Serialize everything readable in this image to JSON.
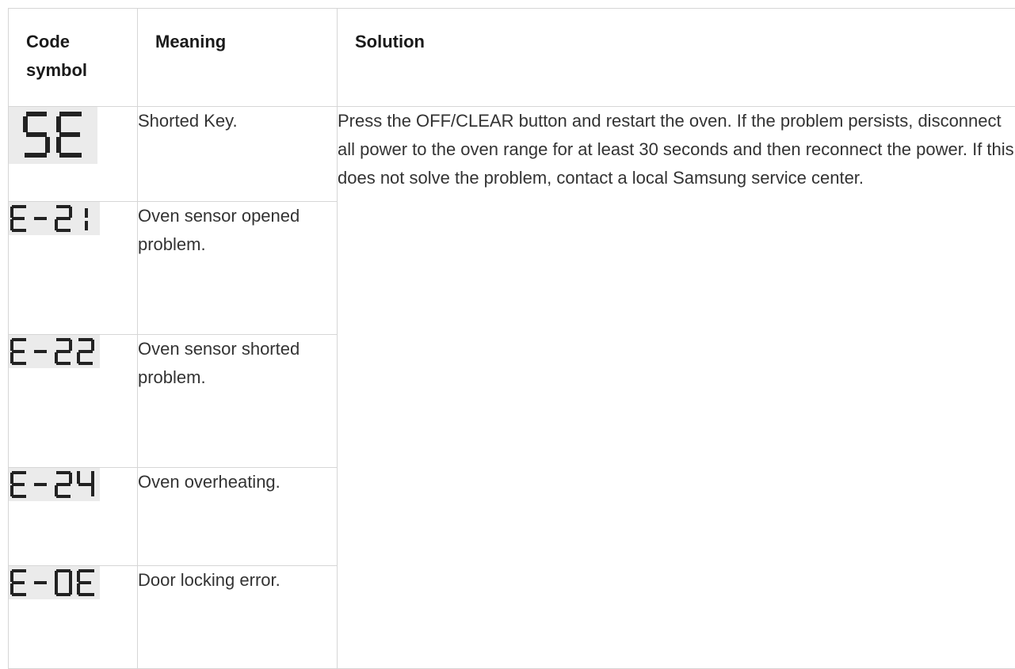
{
  "headers": {
    "code": "Code symbol",
    "meaning": "Meaning",
    "solution": "Solution"
  },
  "rows": [
    {
      "code_icon": "SE-display-icon",
      "code": "SE",
      "meaning": "Shorted Key."
    },
    {
      "code_icon": "E-21-display-icon",
      "code": "E-21",
      "meaning": "Oven sensor opened problem."
    },
    {
      "code_icon": "E-22-display-icon",
      "code": "E-22",
      "meaning": "Oven sensor shorted problem."
    },
    {
      "code_icon": "E-24-display-icon",
      "code": "E-24",
      "meaning": "Oven overheating."
    },
    {
      "code_icon": "E-0E-display-icon",
      "code": "E-0E",
      "meaning": "Door locking error."
    }
  ],
  "solution": "Press the OFF/CLEAR button and restart the oven. If the problem persists, disconnect all power to the oven range for at least 30 seconds and then reconnect the power. If this does not solve the problem, contact a local Samsung service center.",
  "colors": {
    "border": "#d6d6d6",
    "lcd_bg": "#ebebeb",
    "segment": "#222222"
  }
}
